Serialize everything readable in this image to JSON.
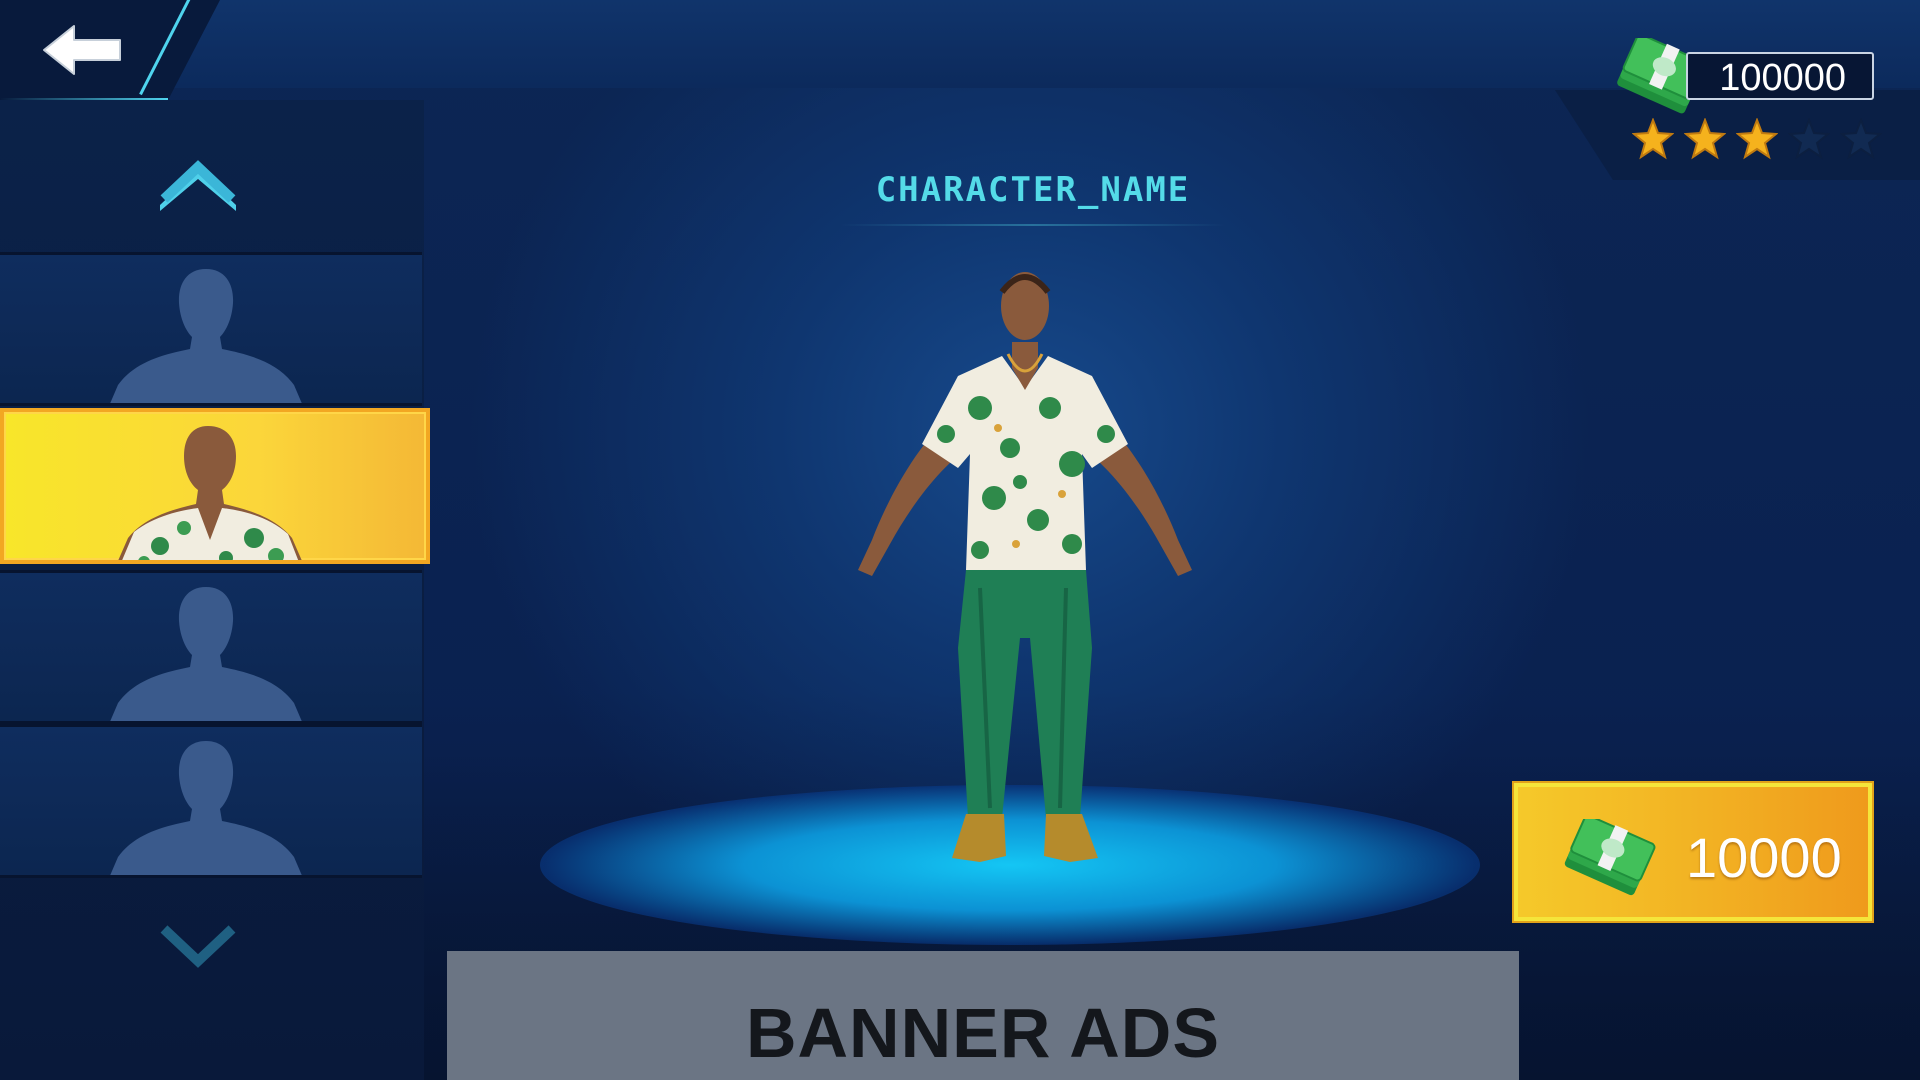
{
  "header": {
    "back_icon": "arrow-left-icon"
  },
  "character": {
    "name": "CHARACTER_NAME"
  },
  "character_list": {
    "up_icon": "chevron-up-icon",
    "down_icon": "chevron-down-icon",
    "slots": [
      {
        "state": "locked",
        "icon": "silhouette-icon"
      },
      {
        "state": "selected",
        "icon": "character-portrait"
      },
      {
        "state": "locked",
        "icon": "silhouette-icon"
      },
      {
        "state": "locked",
        "icon": "silhouette-icon"
      }
    ]
  },
  "wallet": {
    "balance": "100000",
    "icon": "cash-stack-icon",
    "stars_filled": 3,
    "stars_total": 5
  },
  "buy": {
    "price": "10000",
    "icon": "cash-stack-icon"
  },
  "banner": {
    "text": "BANNER ADS"
  },
  "colors": {
    "accent": "#54dbe8",
    "selected_slot": "#f8e62a",
    "buy_button": "#f2b123",
    "star_filled": "#f5b21d",
    "star_empty": "#112a52"
  }
}
